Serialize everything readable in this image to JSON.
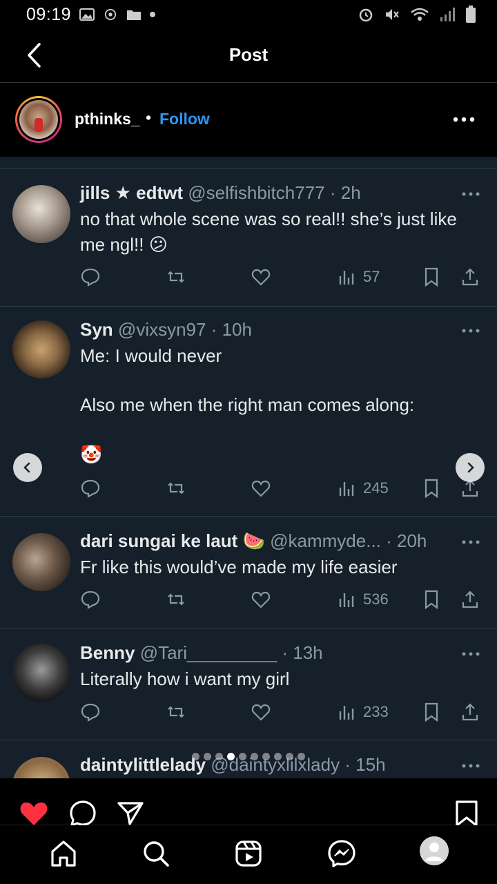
{
  "status_bar": {
    "time": "09:19"
  },
  "header": {
    "title": "Post"
  },
  "post": {
    "username": "pthinks_",
    "separator": "•",
    "follow_label": "Follow"
  },
  "tweets": [
    {
      "name": "jills ★ edtwt",
      "handle": "@selfishbitch777 · 2h",
      "text": "no that whole scene was so real!! she’s just like me ngl!! 😕",
      "views": "57"
    },
    {
      "name": "Syn",
      "handle": "@vixsyn97 · 10h",
      "text_lines": [
        "Me: I would never",
        "Also me when the right man comes along:",
        "🤡"
      ],
      "views": "245"
    },
    {
      "name": "dari sungai ke laut 🍉",
      "handle": "@kammyde... · 20h",
      "text": "Fr like this would’ve made my life easier",
      "views": "536"
    },
    {
      "name": "Benny",
      "handle": "@Tari_________ · 13h",
      "text": "Literally how i want my girl",
      "views": "233"
    },
    {
      "name": "daintylittlelady",
      "handle": "@daintyxlilxlady · 15h"
    }
  ],
  "carousel": {
    "total": 10,
    "active_index": 3
  },
  "colors": {
    "follow": "#2d95f5",
    "like_active": "#ff3040",
    "tweet_bg": "#15202b"
  },
  "icons": {
    "post_actions": [
      "heart-filled-icon",
      "comment-icon",
      "share-icon",
      "bookmark-icon"
    ],
    "nav": [
      "home-icon",
      "search-icon",
      "reels-icon",
      "messenger-icon",
      "profile-avatar"
    ]
  }
}
